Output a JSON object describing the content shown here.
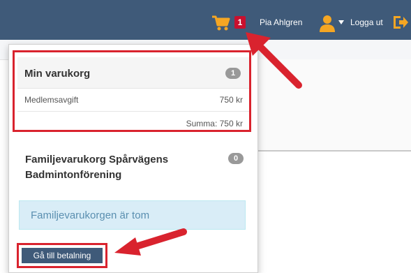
{
  "header": {
    "cart_count": "1",
    "user_name": "Pia Ahlgren",
    "logout_label": "Logga ut"
  },
  "cart_dropdown": {
    "my_cart": {
      "title": "Min varukorg",
      "badge": "1",
      "items": [
        {
          "name": "Medlemsavgift",
          "price": "750 kr"
        }
      ],
      "total": "Summa: 750 kr"
    },
    "family_cart": {
      "title": "Familjevarukorg Spårvägens Badmintonförening",
      "badge": "0",
      "empty_message": "Familjevarukorgen är tom"
    },
    "checkout_button": "Gå till betalning"
  },
  "colors": {
    "topbar": "#3f5a79",
    "highlight": "#d9232e",
    "cart_icon": "#f5a623",
    "alert_bg": "#d9edf7"
  },
  "icons": [
    "shopping-cart-icon",
    "user-icon",
    "caret-down-icon",
    "logout-icon"
  ]
}
